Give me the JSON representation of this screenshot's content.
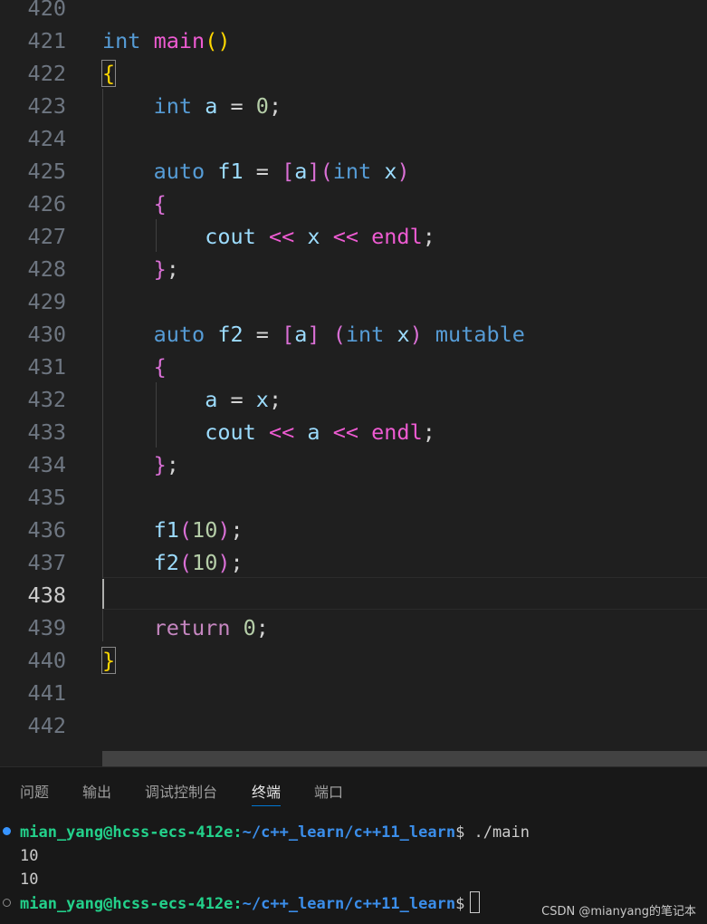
{
  "editor": {
    "lines": [
      {
        "no": "420"
      },
      {
        "no": "421",
        "tokens": [
          [
            "int ",
            "kw"
          ],
          [
            "main",
            "fn-pink"
          ],
          [
            "()",
            "brY"
          ]
        ]
      },
      {
        "no": "422",
        "tokens": [
          [
            "{",
            "brY-box"
          ]
        ]
      },
      {
        "no": "423",
        "tokens": [
          [
            "    "
          ],
          [
            "int ",
            "kw"
          ],
          [
            "a ",
            "var"
          ],
          [
            "= ",
            "pl"
          ],
          [
            "0",
            "num"
          ],
          [
            ";",
            "pl"
          ]
        ]
      },
      {
        "no": "424"
      },
      {
        "no": "425",
        "tokens": [
          [
            "    "
          ],
          [
            "auto ",
            "kw"
          ],
          [
            "f1 ",
            "var"
          ],
          [
            "= ",
            "pl"
          ],
          [
            "[",
            "brP"
          ],
          [
            "a",
            "var"
          ],
          [
            "]",
            "brP"
          ],
          [
            "(",
            "brP"
          ],
          [
            "int ",
            "kw"
          ],
          [
            "x",
            "var"
          ],
          [
            ")",
            "brP"
          ]
        ]
      },
      {
        "no": "426",
        "tokens": [
          [
            "    "
          ],
          [
            "{",
            "brP"
          ]
        ]
      },
      {
        "no": "427",
        "tokens": [
          [
            "        "
          ],
          [
            "cout ",
            "var"
          ],
          [
            "<< ",
            "endl"
          ],
          [
            "x ",
            "var"
          ],
          [
            "<< ",
            "endl"
          ],
          [
            "endl",
            "endl"
          ],
          [
            ";",
            "pl"
          ]
        ]
      },
      {
        "no": "428",
        "tokens": [
          [
            "    "
          ],
          [
            "}",
            "brP"
          ],
          [
            ";",
            "pl"
          ]
        ]
      },
      {
        "no": "429"
      },
      {
        "no": "430",
        "tokens": [
          [
            "    "
          ],
          [
            "auto ",
            "kw"
          ],
          [
            "f2 ",
            "var"
          ],
          [
            "= ",
            "pl"
          ],
          [
            "[",
            "brP"
          ],
          [
            "a",
            "var"
          ],
          [
            "] ",
            "brP"
          ],
          [
            "(",
            "brP"
          ],
          [
            "int ",
            "kw"
          ],
          [
            "x",
            "var"
          ],
          [
            ") ",
            "brP"
          ],
          [
            "mutable",
            "kw"
          ]
        ]
      },
      {
        "no": "431",
        "tokens": [
          [
            "    "
          ],
          [
            "{",
            "brP"
          ]
        ]
      },
      {
        "no": "432",
        "tokens": [
          [
            "        "
          ],
          [
            "a ",
            "var"
          ],
          [
            "= ",
            "pl"
          ],
          [
            "x",
            "var"
          ],
          [
            ";",
            "pl"
          ]
        ]
      },
      {
        "no": "433",
        "tokens": [
          [
            "        "
          ],
          [
            "cout ",
            "var"
          ],
          [
            "<< ",
            "endl"
          ],
          [
            "a ",
            "var"
          ],
          [
            "<< ",
            "endl"
          ],
          [
            "endl",
            "endl"
          ],
          [
            ";",
            "pl"
          ]
        ]
      },
      {
        "no": "434",
        "tokens": [
          [
            "    "
          ],
          [
            "}",
            "brP"
          ],
          [
            ";",
            "pl"
          ]
        ]
      },
      {
        "no": "435"
      },
      {
        "no": "436",
        "tokens": [
          [
            "    "
          ],
          [
            "f1",
            "var"
          ],
          [
            "(",
            "brP"
          ],
          [
            "10",
            "num"
          ],
          [
            ")",
            "brP"
          ],
          [
            ";",
            "pl"
          ]
        ]
      },
      {
        "no": "437",
        "tokens": [
          [
            "    "
          ],
          [
            "f2",
            "var"
          ],
          [
            "(",
            "brP"
          ],
          [
            "10",
            "num"
          ],
          [
            ")",
            "brP"
          ],
          [
            ";",
            "pl"
          ]
        ]
      },
      {
        "no": "438",
        "active": true
      },
      {
        "no": "439",
        "tokens": [
          [
            "    "
          ],
          [
            "return ",
            "ctrl"
          ],
          [
            "0",
            "num"
          ],
          [
            ";",
            "pl"
          ]
        ]
      },
      {
        "no": "440",
        "tokens": [
          [
            "}",
            "brY-box"
          ]
        ]
      },
      {
        "no": "441"
      },
      {
        "no": "442"
      }
    ]
  },
  "panel": {
    "tabs": [
      {
        "label": "问题",
        "active": false
      },
      {
        "label": "输出",
        "active": false
      },
      {
        "label": "调试控制台",
        "active": false
      },
      {
        "label": "终端",
        "active": true
      },
      {
        "label": "端口",
        "active": false
      }
    ],
    "terminal": {
      "prompt_user": "mian_yang@hcss-ecs-412e",
      "prompt_sep": ":",
      "prompt_path": "~/c++_learn/c++11_learn",
      "prompt_symbol": "$",
      "command": " ./main",
      "output": [
        "10",
        "10"
      ]
    },
    "watermark": "CSDN @mianyang的笔记本"
  },
  "colors": {
    "keyword": "#569cd6",
    "variable": "#9cdcfe",
    "number": "#b5cea8",
    "bracket_gold": "#ffd700",
    "bracket_purple": "#da70d6",
    "operator_pink": "#ee5bd2",
    "terminal_user": "#23d18b",
    "terminal_path": "#3b8eea"
  }
}
